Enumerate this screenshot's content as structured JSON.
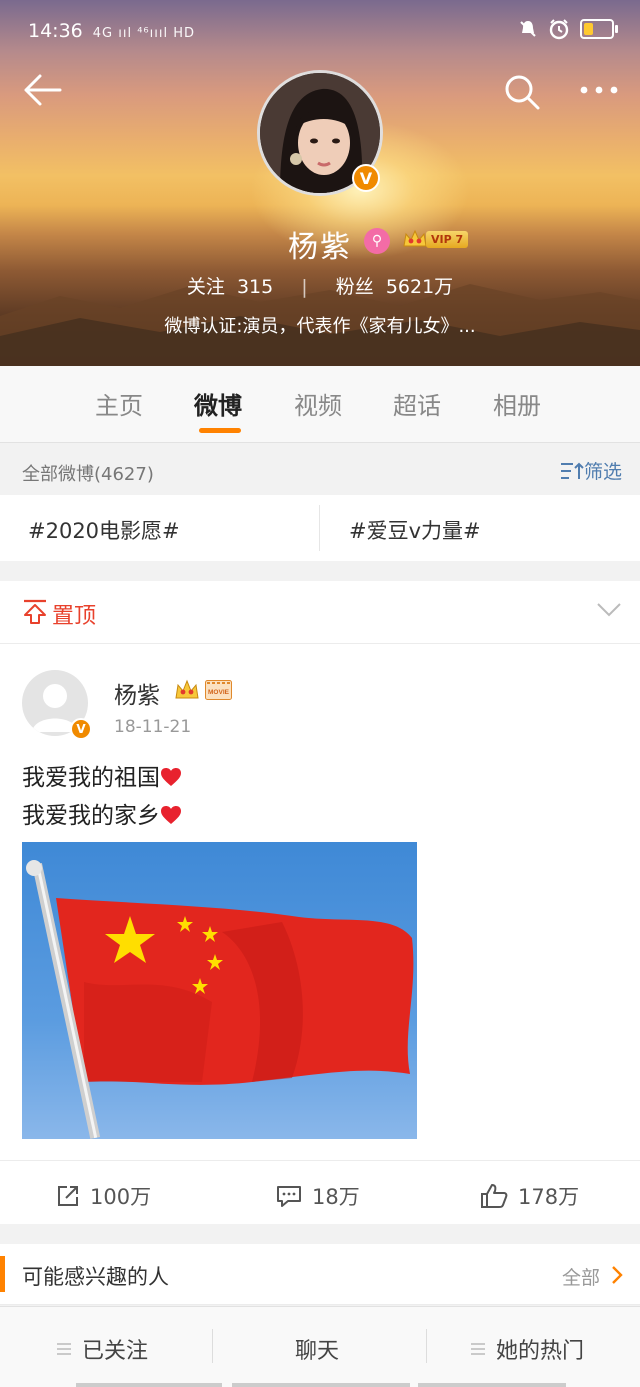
{
  "status_bar": {
    "time": "14:36",
    "signal_text": "4G ııl  ⁴⁶ıııl HD"
  },
  "header": {
    "name": "杨紫",
    "vip_level": "VIP 7",
    "stats": {
      "following_label": "关注",
      "following": "315",
      "fans_label": "粉丝",
      "fans": "5621万"
    },
    "verification": "微博认证:演员，代表作《家有儿女》..."
  },
  "tabs": [
    {
      "label": "主页"
    },
    {
      "label": "微博"
    },
    {
      "label": "视频"
    },
    {
      "label": "超话"
    },
    {
      "label": "相册"
    }
  ],
  "filter": {
    "label": "全部微博(4627)",
    "button": "筛选"
  },
  "topics": [
    "#2020电影愿#",
    "#爱豆v力量#"
  ],
  "pinned": {
    "label": "置顶"
  },
  "post": {
    "author": "杨紫",
    "date": "18-11-21",
    "lines": [
      "我爱我的祖国",
      "我爱我的家乡"
    ],
    "reposts": "100万",
    "comments": "18万",
    "likes": "178万",
    "movie_badge": "MOVIE"
  },
  "interest": {
    "label": "可能感兴趣的人",
    "all": "全部"
  },
  "bottom_bar": {
    "following": "已关注",
    "chat": "聊天",
    "hot": "她的热门"
  },
  "colors": {
    "accent": "#ff8200",
    "pin_red": "#e8412c",
    "link_blue": "#507daf",
    "vip_gold": "#e6a820"
  }
}
